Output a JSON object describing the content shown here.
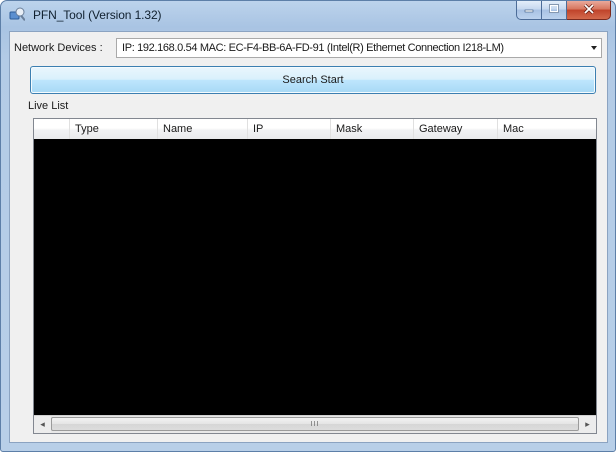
{
  "window": {
    "title": "PFN_Tool (Version 1.32)"
  },
  "network": {
    "label": "Network Devices :",
    "selected": "IP: 192.168.0.54  MAC: EC-F4-BB-6A-FD-91 (Intel(R) Ethernet Connection I218-LM)"
  },
  "search_button": "Search Start",
  "live_list": {
    "label": "Live List",
    "columns": [
      "",
      "Type",
      "Name",
      "IP",
      "Mask",
      "Gateway",
      "Mac"
    ],
    "rows": []
  },
  "scrollbar": {
    "grip": "III"
  },
  "colors": {
    "list_background": "#000000",
    "button_border": "#3c7fb1",
    "close_button": "#c0432a"
  }
}
